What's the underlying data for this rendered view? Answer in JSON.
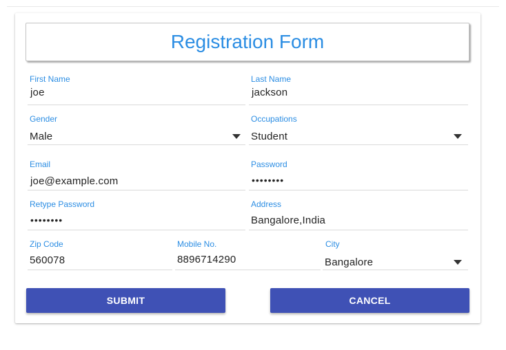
{
  "form": {
    "title": "Registration Form",
    "first_name": {
      "label": "First Name",
      "value": "joe"
    },
    "last_name": {
      "label": "Last Name",
      "value": "jackson"
    },
    "gender": {
      "label": "Gender",
      "value": "Male"
    },
    "occupations": {
      "label": "Occupations",
      "value": "Student"
    },
    "email": {
      "label": "Email",
      "value": "joe@example.com"
    },
    "password": {
      "label": "Password",
      "value": "••••••••"
    },
    "retype_password": {
      "label": "Retype Password",
      "value": "••••••••"
    },
    "address": {
      "label": "Address",
      "value": "Bangalore,India"
    },
    "zip_code": {
      "label": "Zip Code",
      "value": "560078"
    },
    "mobile": {
      "label": "Mobile No.",
      "value": "8896714290"
    },
    "city": {
      "label": "City",
      "value": "Bangalore"
    }
  },
  "buttons": {
    "submit_label": "SUBMIT",
    "cancel_label": "CANCEL"
  },
  "colors": {
    "accent": "#2b8de3",
    "button": "#3f51b5",
    "underline": "#dadada"
  },
  "icons": {
    "dropdown": "chevron-down-icon"
  }
}
